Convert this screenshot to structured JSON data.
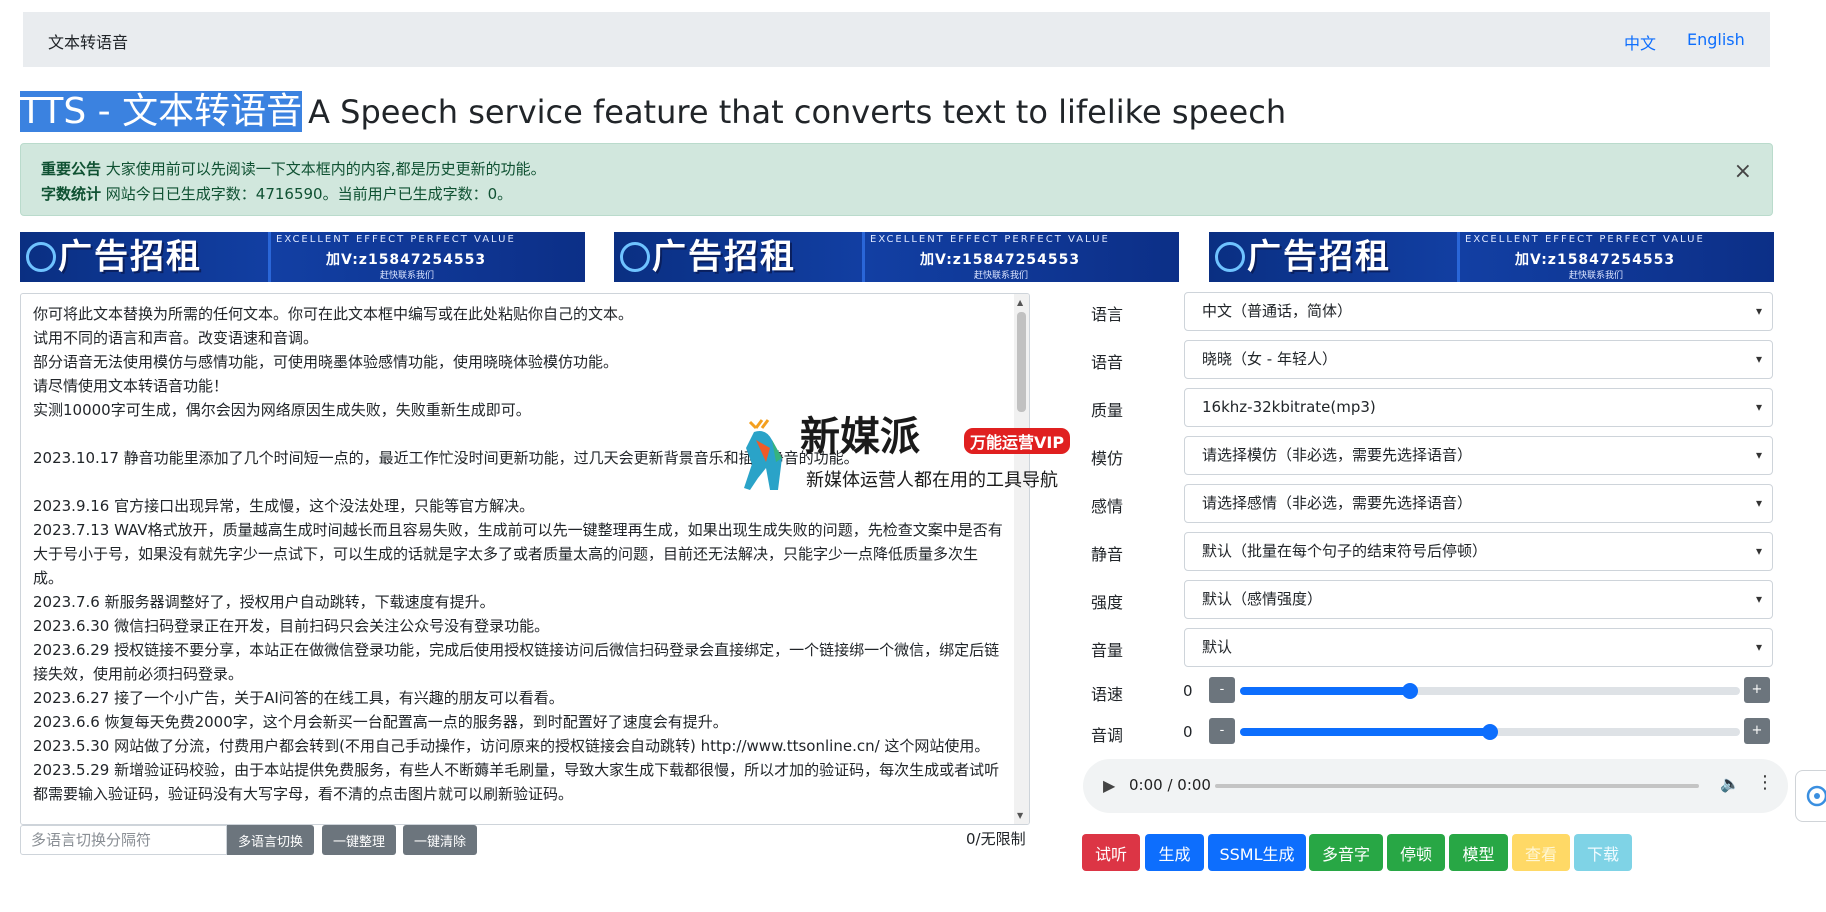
{
  "navbar": {
    "brand": "文本转语音",
    "lang_zh": "中文",
    "lang_en": "English"
  },
  "title": {
    "main": "TTS - 文本转语音",
    "sub": "A Speech service feature that converts text to lifelike speech"
  },
  "alert": {
    "label1": "重要公告",
    "text1": "大家使用前可以先阅读一下文本框内的内容,都是历史更新的功能。",
    "label2": "字数统计",
    "text2": "网站今日已生成字数：4716590。当前用户已生成字数：0。",
    "close": "×"
  },
  "ad": {
    "big": "广告招租",
    "tagline": "EXCELLENT EFFECT PERFECT VALUE",
    "phone": "加V:z15847254553",
    "small": "赶快联系我们"
  },
  "textarea": {
    "content": "你可将此文本替换为所需的任何文本。你可在此文本框中编写或在此处粘贴你自己的文本。\n试用不同的语言和声音。改变语速和音调。\n部分语音无法使用模仿与感情功能，可使用晓墨体验感情功能，使用晓晓体验模仿功能。\n请尽情使用文本转语音功能！\n实测10000字可生成，偶尔会因为网络原因生成失败，失败重新生成即可。\n\n2023.10.17 静音功能里添加了几个时间短一点的，最近工作忙没时间更新功能，过几天会更新背景音乐和插入静音的功能。\n\n2023.9.16 官方接口出现异常，生成慢，这个没法处理，只能等官方解决。\n2023.7.13 WAV格式放开，质量越高生成时间越长而且容易失败，生成前可以先一键整理再生成，如果出现生成失败的问题，先检查文案中是否有大于号小于号，如果没有就先字少一点试下，可以生成的话就是字太多了或者质量太高的问题，目前还无法解决，只能字少一点降低质量多次生成。\n2023.7.6 新服务器调整好了，授权用户自动跳转，下载速度有提升。\n2023.6.30 微信扫码登录正在开发，目前扫码只会关注公众号没有登录功能。\n2023.6.29 授权链接不要分享，本站正在做微信登录功能，完成后使用授权链接访问后微信扫码登录会直接绑定，一个链接绑一个微信，绑定后链接失效，使用前必须扫码登录。\n2023.6.27 接了一个小广告，关于AI问答的在线工具，有兴趣的朋友可以看看。\n2023.6.6 恢复每天免费2000字，这个月会新买一台配置高一点的服务器，到时配置好了速度会有提升。\n2023.5.30 网站做了分流，付费用户都会转到(不用自己手动操作，访问原来的授权链接会自动跳转) http://www.ttsonline.cn/ 这个网站使用。\n2023.5.29 新增验证码校验，由于本站提供免费服务，有些人不断薅羊毛刷量，导致大家生成下载都很慢，所以才加的验证码，每次生成或者试听都需要输入验证码，验证码没有大写字母，看不清的点击图片就可以刷新验证码。"
  },
  "bottom": {
    "placeholder": "多语言切换分隔符",
    "btn_multilang": "多语言切换",
    "btn_organize": "一键整理",
    "btn_clear": "一键清除",
    "char_count": "0/无限制"
  },
  "form": {
    "language": {
      "label": "语言",
      "value": "中文（普通话，简体）"
    },
    "voice": {
      "label": "语音",
      "value": "晓晓（女 - 年轻人）"
    },
    "quality": {
      "label": "质量",
      "value": "16khz-32kbitrate(mp3)"
    },
    "imitate": {
      "label": "模仿",
      "value": "请选择模仿（非必选，需要先选择语音）"
    },
    "emotion": {
      "label": "感情",
      "value": "请选择感情（非必选，需要先选择语音）"
    },
    "silence": {
      "label": "静音",
      "value": "默认（批量在每个句子的结束符号后停顿）"
    },
    "strength": {
      "label": "强度",
      "value": "默认（感情强度）"
    },
    "volume": {
      "label": "音量",
      "value": "默认"
    },
    "rate": {
      "label": "语速",
      "value": "0",
      "minus": "-",
      "plus": "+",
      "level": 0.34
    },
    "pitch": {
      "label": "音调",
      "value": "0",
      "minus": "-",
      "plus": "+",
      "level": 0.5
    }
  },
  "audio": {
    "time": "0:00 / 0:00"
  },
  "actions": {
    "listen": "试听",
    "generate": "生成",
    "ssml": "SSML生成",
    "polyphone": "多音字",
    "pause": "停顿",
    "model": "模型",
    "view": "查看",
    "download": "下载"
  },
  "watermark": {
    "title": "新媒派",
    "badge": "万能运营VIP",
    "sub": "新媒体运营人都在用的工具导航"
  },
  "colors": {
    "primary": "#0d6efd",
    "danger": "#dc3545",
    "success": "#28a745",
    "warning": "#ffd966",
    "info": "#7fd3e6",
    "alert_bg": "#d1e7dd"
  }
}
